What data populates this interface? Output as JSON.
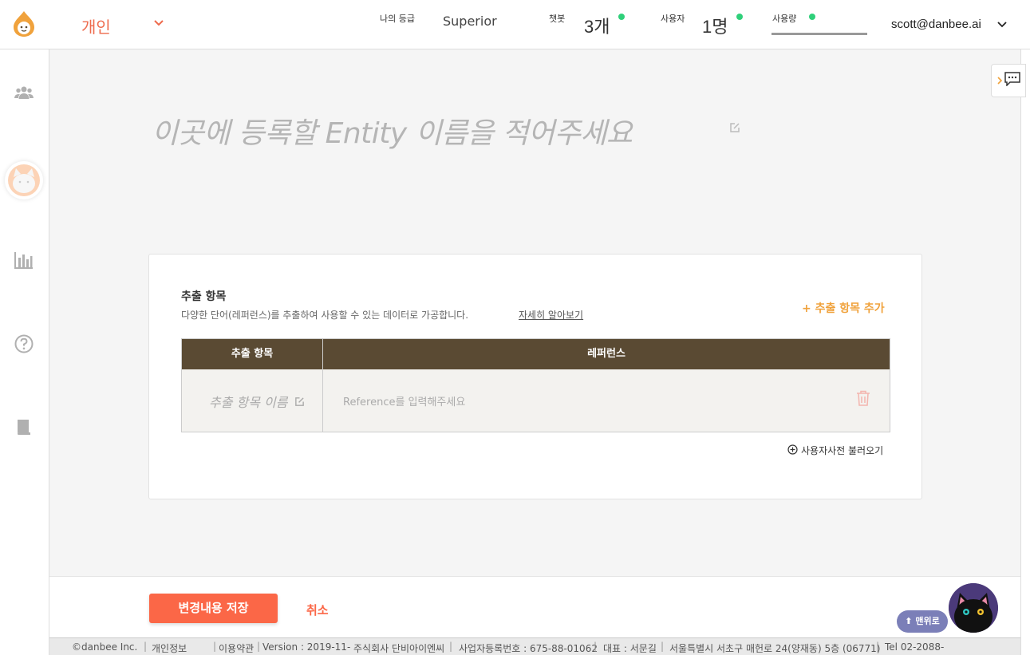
{
  "header": {
    "workspace": "개인",
    "grade_label": "나의 등급",
    "grade_value": "Superior",
    "chatbot_label": "챗봇",
    "chatbot_value": "3개",
    "users_label": "사용자",
    "users_value": "1명",
    "usage_label": "사용량",
    "account": "scott@danbee.ai",
    "status_color": "#2fd07a",
    "brand_color": "#ee6b4d"
  },
  "sidebar": {
    "items": [
      {
        "icon": "users-icon"
      },
      {
        "icon": "cat-avatar-icon"
      },
      {
        "icon": "bar-chart-icon"
      },
      {
        "icon": "help-icon"
      },
      {
        "icon": "book-icon"
      }
    ]
  },
  "entity": {
    "title_placeholder": "이곳에 등록할 Entity 이름을 적어주세요"
  },
  "card": {
    "title": "추출 항목",
    "description": "다양한 단어(레퍼런스)를 추출하여 사용할 수 있는 데이터로 가공합니다.",
    "learn_more": "자세히 알아보기",
    "add_label": "+ 추출 항목 추가",
    "table": {
      "col_name": "추출 항목",
      "col_reference": "레퍼런스",
      "rows": [
        {
          "name_placeholder": "추출 항목 이름",
          "reference_placeholder": "Reference를 입력해주세요"
        }
      ]
    },
    "load_dict": "사용자사전 불러오기"
  },
  "actions": {
    "save": "변경내용 저장",
    "cancel": "취소",
    "to_top": "⬆ 맨위로"
  },
  "footer": {
    "items": [
      "©danbee Inc.",
      "개인정보",
      "이용약관",
      "Version : 2019-11-",
      "주식회사 단비아이엔씨",
      "사업자등록번호 : 675-88-01062",
      "대표 : 서문길",
      "서울특별시 서초구 매헌로 24(양재동) 5층 (06771)",
      "Tel 02-2088-"
    ]
  }
}
